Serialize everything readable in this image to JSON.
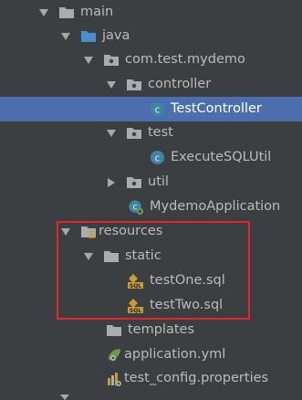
{
  "tree": {
    "items": [
      {
        "label": "main",
        "icon": "folder-icon",
        "expanded": true
      },
      {
        "label": "java",
        "icon": "source-folder-icon",
        "expanded": true
      },
      {
        "label": "com.test.mydemo",
        "icon": "package-icon",
        "expanded": true
      },
      {
        "label": "controller",
        "icon": "package-icon",
        "expanded": true
      },
      {
        "label": "TestController",
        "icon": "class-icon",
        "selected": true
      },
      {
        "label": "test",
        "icon": "package-icon",
        "expanded": true
      },
      {
        "label": "ExecuteSQLUtil",
        "icon": "class-icon"
      },
      {
        "label": "util",
        "icon": "package-icon",
        "expanded": false
      },
      {
        "label": "MydemoApplication",
        "icon": "spring-boot-class-icon"
      },
      {
        "label": "resources",
        "icon": "resources-folder-icon",
        "expanded": true
      },
      {
        "label": "static",
        "icon": "folder-icon",
        "expanded": true
      },
      {
        "label": "testOne.sql",
        "icon": "sql-file-icon"
      },
      {
        "label": "testTwo.sql",
        "icon": "sql-file-icon"
      },
      {
        "label": "templates",
        "icon": "folder-icon"
      },
      {
        "label": "application.yml",
        "icon": "yml-file-icon"
      },
      {
        "label": "test_config.properties",
        "icon": "properties-file-icon"
      }
    ]
  },
  "annotation": {
    "highlight_color": "#e3262b"
  },
  "colors": {
    "background": "#3c3f41",
    "selection": "#4b6eaf",
    "text": "#bbbbbb",
    "folder": "#a8adb0",
    "source_folder": "#4a8fc7",
    "class_icon": "#3e86a0",
    "sql_icon": "#c99b34"
  }
}
